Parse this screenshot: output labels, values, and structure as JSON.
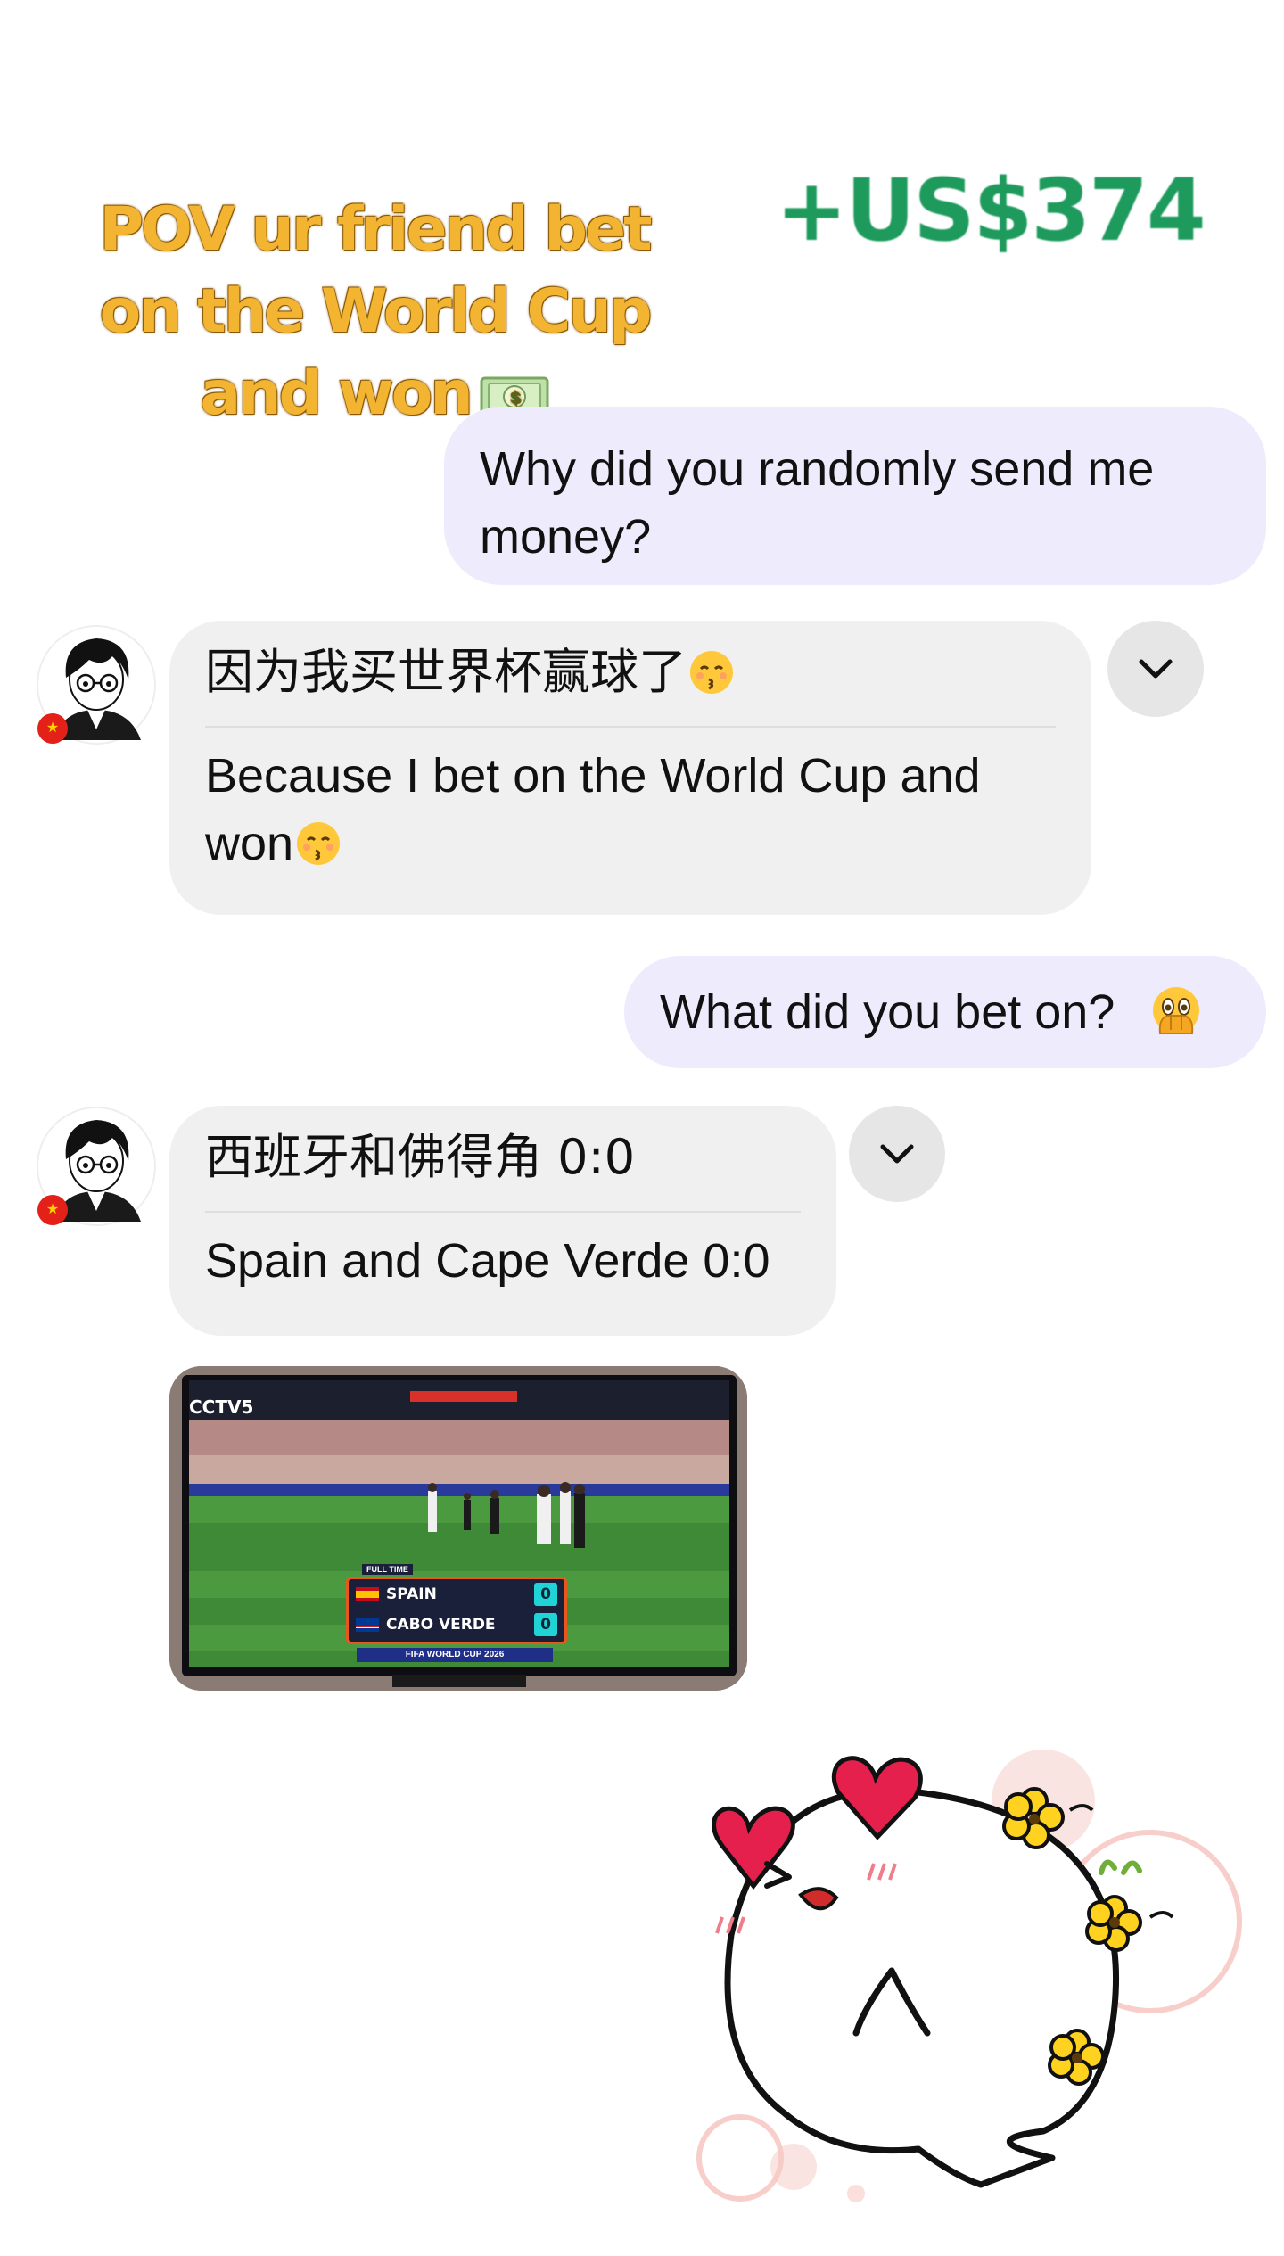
{
  "overlay": {
    "caption_lines": [
      "POV ur friend bet",
      "on the World Cup",
      "and won"
    ],
    "caption_emoji": "money-bill-emoji",
    "amount": "+US$374",
    "amount_color": "#1d9a5c",
    "caption_color": "#f2b431"
  },
  "messages": [
    {
      "from": "me",
      "text": "Why did you randomly send me money?"
    },
    {
      "from": "friend",
      "original": "因为我买世界杯赢球了",
      "original_emoji": "kissing-face-emoji",
      "translation": "Because I bet on the World Cup and won",
      "translation_emoji": "kissing-face-emoji",
      "avatar": "anime-avatar-with-china-flag"
    },
    {
      "from": "me",
      "text": "What did you bet on?",
      "emoji": "face-with-open-eyes-and-hand-over-mouth-emoji"
    },
    {
      "from": "friend",
      "original": "西班牙和佛得角 0:0",
      "translation": "Spain and Cape Verde 0:0",
      "avatar": "anime-avatar-with-china-flag"
    }
  ],
  "photo": {
    "channel": "CCTV5",
    "full_time_label": "FULL TIME",
    "team1": "SPAIN",
    "team1_score": "0",
    "team2": "CABO VERDE",
    "team2_score": "0",
    "tournament": "FIFA WORLD CUP 2026"
  },
  "sticker": "ghost-with-heart-eyes-sticker",
  "colors": {
    "outgoing_bubble": "#eeebfd",
    "incoming_bubble": "#f0f0f0"
  }
}
